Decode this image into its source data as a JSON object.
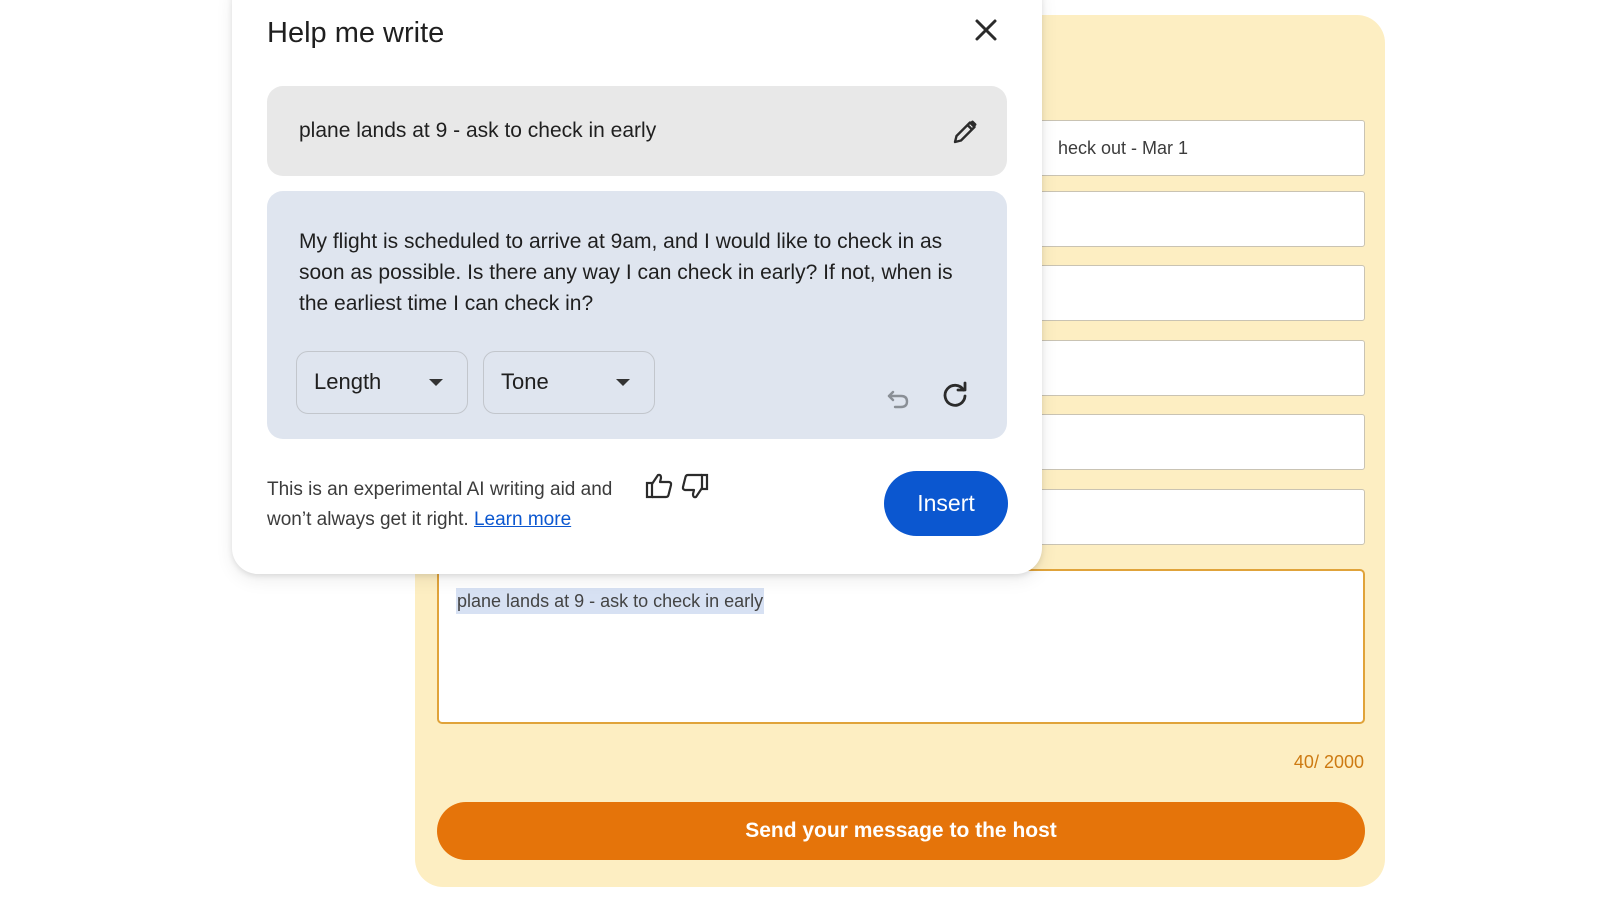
{
  "form": {
    "fields": [
      "heck out - Mar 1",
      "",
      "",
      "",
      "",
      ""
    ],
    "message_value": "plane lands at 9 - ask to check in early",
    "char_counter": "40/ 2000",
    "send_label": "Send your message to the host"
  },
  "dialog": {
    "title": "Help me write",
    "prompt": "plane lands at 9 - ask to check in early",
    "result": "My flight is scheduled to arrive at 9am, and I would like to check in as soon as possible. Is there any way I can check in early? If not, when is the earliest time I can check in?",
    "length_label": "Length",
    "tone_label": "Tone",
    "disclaimer": "This is an experimental AI writing aid and won’t always get it right.",
    "learn_more": "Learn more",
    "insert_label": "Insert"
  },
  "colors": {
    "form_bg": "#fdeec2",
    "accent_orange": "#e5740a",
    "insert_blue": "#0b57d0",
    "prompt_bg": "#e8e8e8",
    "result_bg": "#dfe5ef"
  },
  "icons": [
    "close-icon",
    "pencil-icon",
    "chevron-down-icon",
    "undo-icon",
    "refresh-icon",
    "thumbs-up-icon",
    "thumbs-down-icon"
  ]
}
